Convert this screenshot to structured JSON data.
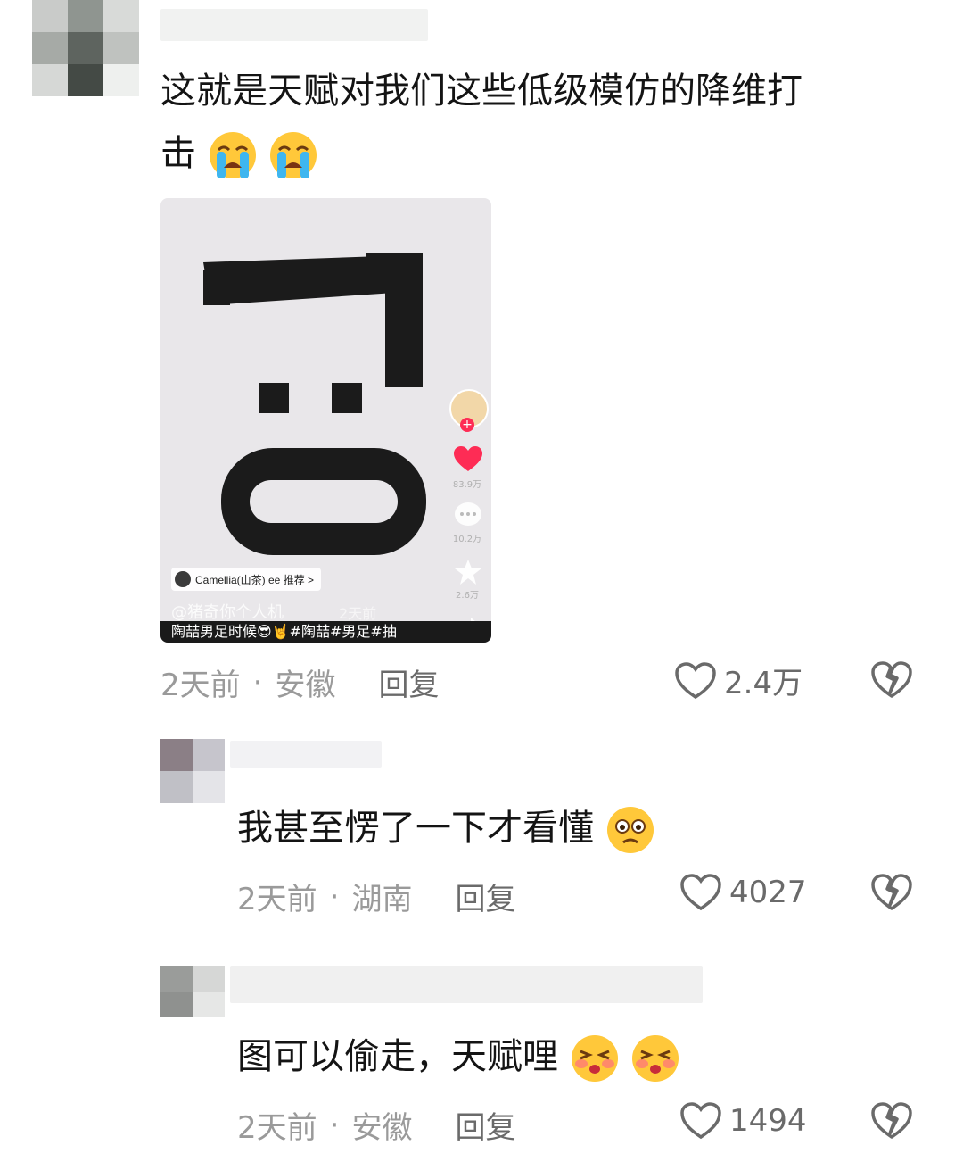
{
  "comments": [
    {
      "text_line1": "这就是天赋对我们这些低级模仿的降维打",
      "text_line2": "击",
      "emoji": [
        "crying-face",
        "crying-face"
      ],
      "time": "2天前",
      "location": "安徽",
      "reply": "回复",
      "likes": "2.4万"
    },
    {
      "text": "我甚至愣了一下才看懂",
      "emoji": [
        "worried-face"
      ],
      "time": "2天前",
      "location": "湖南",
      "reply": "回复",
      "likes": "4027"
    },
    {
      "text": "图可以偷走，天赋哩",
      "emoji": [
        "kissing-blush-face",
        "kissing-blush-face"
      ],
      "time": "2天前",
      "location": "安徽",
      "reply": "回复",
      "likes": "1494"
    }
  ],
  "video": {
    "pill": "Camellia(山茶) ee 推荐 >",
    "author": "@猪奇你个人机",
    "time": "2天前",
    "caption": "陶喆男足时候😎🤘#陶喆#男足#抽",
    "likes": "83.9万",
    "comments": "10.2万",
    "favorites": "2.6万"
  },
  "separator": "·"
}
